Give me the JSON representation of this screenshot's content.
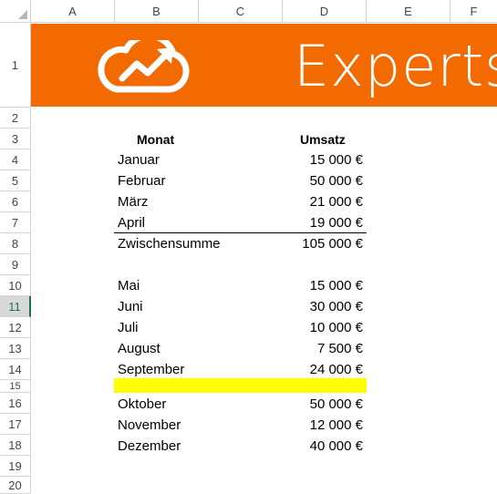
{
  "columns": [
    "A",
    "B",
    "C",
    "D",
    "E",
    "F"
  ],
  "rows": [
    "1",
    "2",
    "3",
    "4",
    "5",
    "6",
    "7",
    "8",
    "9",
    "10",
    "11",
    "12",
    "13",
    "14",
    "15",
    "16",
    "17",
    "18",
    "19",
    "20"
  ],
  "banner": {
    "text": "Experts",
    "color": "#f26a00",
    "icon": "cloud-growth-icon"
  },
  "table": {
    "header_month": "Monat",
    "header_sales": "Umsatz",
    "group1": [
      {
        "month": "Januar",
        "value": "15 000 €"
      },
      {
        "month": "Februar",
        "value": "50 000 €"
      },
      {
        "month": "März",
        "value": "21 000 €"
      },
      {
        "month": "April",
        "value": "19 000 €"
      }
    ],
    "subtotal": {
      "label": "Zwischensumme",
      "value": "105 000 €"
    },
    "group2": [
      {
        "month": "Mai",
        "value": "15 000 €"
      },
      {
        "month": "Juni",
        "value": "30 000 €"
      },
      {
        "month": "Juli",
        "value": "10 000 €"
      },
      {
        "month": "August",
        "value": "7 500 €"
      },
      {
        "month": "September",
        "value": "24 000 €"
      }
    ],
    "group3": [
      {
        "month": "Oktober",
        "value": "50 000 €"
      },
      {
        "month": "November",
        "value": "12 000 €"
      },
      {
        "month": "Dezember",
        "value": "40 000 €"
      }
    ]
  },
  "active_row": "11",
  "highlight_color": "#ffff00"
}
